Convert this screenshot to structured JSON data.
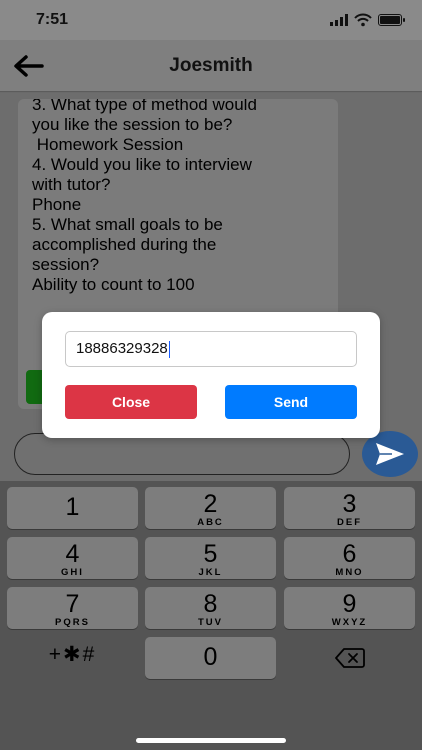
{
  "status": {
    "time": "7:51"
  },
  "header": {
    "title": "Joesmith"
  },
  "message": {
    "lines": [
      "3. What type of method would",
      "you like the session to be?",
      " Homework Session",
      "4. Would you like to interview",
      "with tutor?",
      "Phone",
      "5. What small goals to be",
      "accomplished during the",
      "session?",
      "Ability to count to 100"
    ]
  },
  "dialog": {
    "phone_value": "18886329328",
    "close_label": "Close",
    "send_label": "Send"
  },
  "keypad": {
    "keys": [
      {
        "digit": "1",
        "letters": ""
      },
      {
        "digit": "2",
        "letters": "ABC"
      },
      {
        "digit": "3",
        "letters": "DEF"
      },
      {
        "digit": "4",
        "letters": "GHI"
      },
      {
        "digit": "5",
        "letters": "JKL"
      },
      {
        "digit": "6",
        "letters": "MNO"
      },
      {
        "digit": "7",
        "letters": "PQRS"
      },
      {
        "digit": "8",
        "letters": "TUV"
      },
      {
        "digit": "9",
        "letters": "WXYZ"
      },
      {
        "digit": "0",
        "letters": ""
      }
    ],
    "symbols_label": "+✱#"
  },
  "colors": {
    "close_button": "#dc3545",
    "send_button": "#007bff",
    "caret": "#1a5cff"
  }
}
